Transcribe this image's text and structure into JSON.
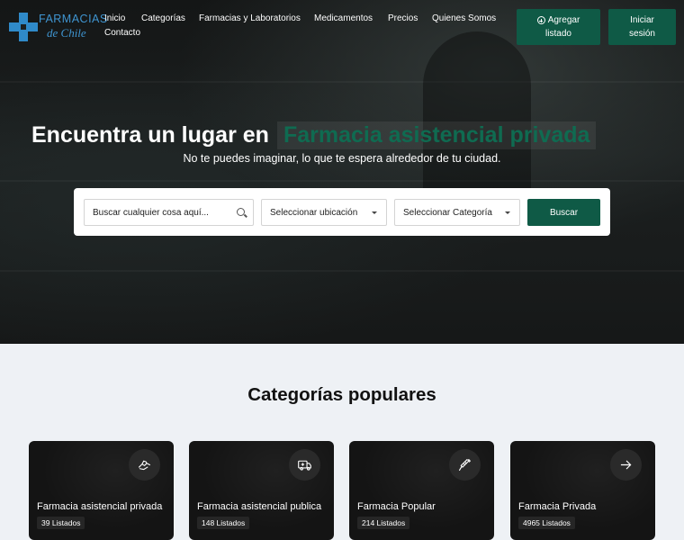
{
  "logo": {
    "line1": "FARMACIAS",
    "line2": "de Chile"
  },
  "nav": {
    "items": [
      {
        "label": "Inicio"
      },
      {
        "label": "Categorías"
      },
      {
        "label": "Farmacias y Laboratorios"
      },
      {
        "label": "Medicamentos"
      },
      {
        "label": "Precios"
      },
      {
        "label": "Quienes Somos"
      },
      {
        "label": "Contacto"
      }
    ]
  },
  "header_buttons": {
    "add_line1": "Agregar",
    "add_line2": "listado",
    "login_line1": "Iniciar",
    "login_line2": "sesión"
  },
  "hero": {
    "title_static": "Encuentra un lugar en",
    "title_highlight": "Farmacia asistencial privada",
    "subtitle": "No te puedes imaginar, lo que te espera alrededor de tu ciudad."
  },
  "search": {
    "query_placeholder": "Buscar cualquier cosa aquí...",
    "location_label": "Seleccionar ubicación",
    "category_label": "Seleccionar Categoría",
    "button_label": "Buscar"
  },
  "categories": {
    "title": "Categorías populares",
    "items": [
      {
        "name": "Farmacia asistencial privada",
        "count": "39 Listados",
        "icon": "hands-heart-icon"
      },
      {
        "name": "Farmacia asistencial publica",
        "count": "148 Listados",
        "icon": "ambulance-icon"
      },
      {
        "name": "Farmacia Popular",
        "count": "214 Listados",
        "icon": "syringe-icon"
      },
      {
        "name": "Farmacia Privada",
        "count": "4965 Listados",
        "icon": "arrow-right-icon"
      }
    ]
  },
  "colors": {
    "primary": "#0f5a46",
    "highlight_text": "#0f6b51",
    "logo_blue": "#2f8ac9"
  }
}
